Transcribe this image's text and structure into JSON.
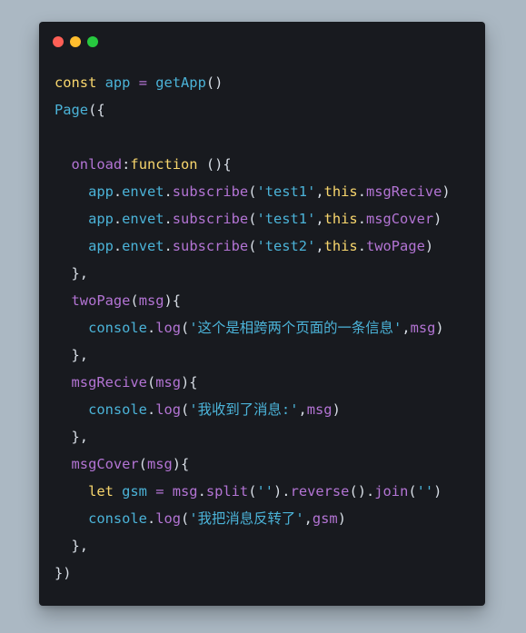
{
  "window": {
    "background": "#181a1f",
    "dots": [
      {
        "name": "close-dot",
        "color": "#ff5f56"
      },
      {
        "name": "minimize-dot",
        "color": "#ffbd2e"
      },
      {
        "name": "maximize-dot",
        "color": "#27c93f"
      }
    ]
  },
  "colors": {
    "keyword": "#f8d66d",
    "identifier": "#4bb3d8",
    "method": "#b374d4",
    "string": "#4bb3d8",
    "punct": "#d8dee6"
  },
  "code": {
    "lines": [
      [
        {
          "t": "const ",
          "c": "keyword"
        },
        {
          "t": "app",
          "c": "identifier"
        },
        {
          "t": " = ",
          "c": "method"
        },
        {
          "t": "getApp",
          "c": "identifier"
        },
        {
          "t": "()",
          "c": "punct"
        }
      ],
      [
        {
          "t": "Page",
          "c": "identifier"
        },
        {
          "t": "({",
          "c": "punct"
        }
      ],
      [],
      [
        {
          "t": "  onload",
          "c": "method"
        },
        {
          "t": ":",
          "c": "punct"
        },
        {
          "t": "function",
          "c": "keyword"
        },
        {
          "t": " (){",
          "c": "punct"
        }
      ],
      [
        {
          "t": "    app",
          "c": "identifier"
        },
        {
          "t": ".",
          "c": "punct"
        },
        {
          "t": "envet",
          "c": "identifier"
        },
        {
          "t": ".",
          "c": "punct"
        },
        {
          "t": "subscribe",
          "c": "method"
        },
        {
          "t": "(",
          "c": "punct"
        },
        {
          "t": "'test1'",
          "c": "string"
        },
        {
          "t": ",",
          "c": "punct"
        },
        {
          "t": "this",
          "c": "keyword"
        },
        {
          "t": ".",
          "c": "punct"
        },
        {
          "t": "msgRecive",
          "c": "method"
        },
        {
          "t": ")",
          "c": "punct"
        }
      ],
      [
        {
          "t": "    app",
          "c": "identifier"
        },
        {
          "t": ".",
          "c": "punct"
        },
        {
          "t": "envet",
          "c": "identifier"
        },
        {
          "t": ".",
          "c": "punct"
        },
        {
          "t": "subscribe",
          "c": "method"
        },
        {
          "t": "(",
          "c": "punct"
        },
        {
          "t": "'test1'",
          "c": "string"
        },
        {
          "t": ",",
          "c": "punct"
        },
        {
          "t": "this",
          "c": "keyword"
        },
        {
          "t": ".",
          "c": "punct"
        },
        {
          "t": "msgCover",
          "c": "method"
        },
        {
          "t": ")",
          "c": "punct"
        }
      ],
      [
        {
          "t": "    app",
          "c": "identifier"
        },
        {
          "t": ".",
          "c": "punct"
        },
        {
          "t": "envet",
          "c": "identifier"
        },
        {
          "t": ".",
          "c": "punct"
        },
        {
          "t": "subscribe",
          "c": "method"
        },
        {
          "t": "(",
          "c": "punct"
        },
        {
          "t": "'test2'",
          "c": "string"
        },
        {
          "t": ",",
          "c": "punct"
        },
        {
          "t": "this",
          "c": "keyword"
        },
        {
          "t": ".",
          "c": "punct"
        },
        {
          "t": "twoPage",
          "c": "method"
        },
        {
          "t": ")",
          "c": "punct"
        }
      ],
      [
        {
          "t": "  },",
          "c": "punct"
        }
      ],
      [
        {
          "t": "  twoPage",
          "c": "method"
        },
        {
          "t": "(",
          "c": "punct"
        },
        {
          "t": "msg",
          "c": "method"
        },
        {
          "t": "){",
          "c": "punct"
        }
      ],
      [
        {
          "t": "    console",
          "c": "identifier"
        },
        {
          "t": ".",
          "c": "punct"
        },
        {
          "t": "log",
          "c": "method"
        },
        {
          "t": "(",
          "c": "punct"
        },
        {
          "t": "'这个是相跨两个页面的一条信息'",
          "c": "string"
        },
        {
          "t": ",",
          "c": "punct"
        },
        {
          "t": "msg",
          "c": "method"
        },
        {
          "t": ")",
          "c": "punct"
        }
      ],
      [
        {
          "t": "  },",
          "c": "punct"
        }
      ],
      [
        {
          "t": "  msgRecive",
          "c": "method"
        },
        {
          "t": "(",
          "c": "punct"
        },
        {
          "t": "msg",
          "c": "method"
        },
        {
          "t": "){",
          "c": "punct"
        }
      ],
      [
        {
          "t": "    console",
          "c": "identifier"
        },
        {
          "t": ".",
          "c": "punct"
        },
        {
          "t": "log",
          "c": "method"
        },
        {
          "t": "(",
          "c": "punct"
        },
        {
          "t": "'我收到了消息:'",
          "c": "string"
        },
        {
          "t": ",",
          "c": "punct"
        },
        {
          "t": "msg",
          "c": "method"
        },
        {
          "t": ")",
          "c": "punct"
        }
      ],
      [
        {
          "t": "  },",
          "c": "punct"
        }
      ],
      [
        {
          "t": "  msgCover",
          "c": "method"
        },
        {
          "t": "(",
          "c": "punct"
        },
        {
          "t": "msg",
          "c": "method"
        },
        {
          "t": "){",
          "c": "punct"
        }
      ],
      [
        {
          "t": "    let ",
          "c": "keyword"
        },
        {
          "t": "gsm",
          "c": "identifier"
        },
        {
          "t": " = ",
          "c": "method"
        },
        {
          "t": "msg",
          "c": "method"
        },
        {
          "t": ".",
          "c": "punct"
        },
        {
          "t": "split",
          "c": "method"
        },
        {
          "t": "(",
          "c": "punct"
        },
        {
          "t": "''",
          "c": "string"
        },
        {
          "t": ").",
          "c": "punct"
        },
        {
          "t": "reverse",
          "c": "method"
        },
        {
          "t": "().",
          "c": "punct"
        },
        {
          "t": "join",
          "c": "method"
        },
        {
          "t": "(",
          "c": "punct"
        },
        {
          "t": "''",
          "c": "string"
        },
        {
          "t": ")",
          "c": "punct"
        }
      ],
      [
        {
          "t": "    console",
          "c": "identifier"
        },
        {
          "t": ".",
          "c": "punct"
        },
        {
          "t": "log",
          "c": "method"
        },
        {
          "t": "(",
          "c": "punct"
        },
        {
          "t": "'我把消息反转了'",
          "c": "string"
        },
        {
          "t": ",",
          "c": "punct"
        },
        {
          "t": "gsm",
          "c": "method"
        },
        {
          "t": ")",
          "c": "punct"
        }
      ],
      [
        {
          "t": "  },",
          "c": "punct"
        }
      ],
      [
        {
          "t": "})",
          "c": "punct"
        }
      ]
    ]
  }
}
